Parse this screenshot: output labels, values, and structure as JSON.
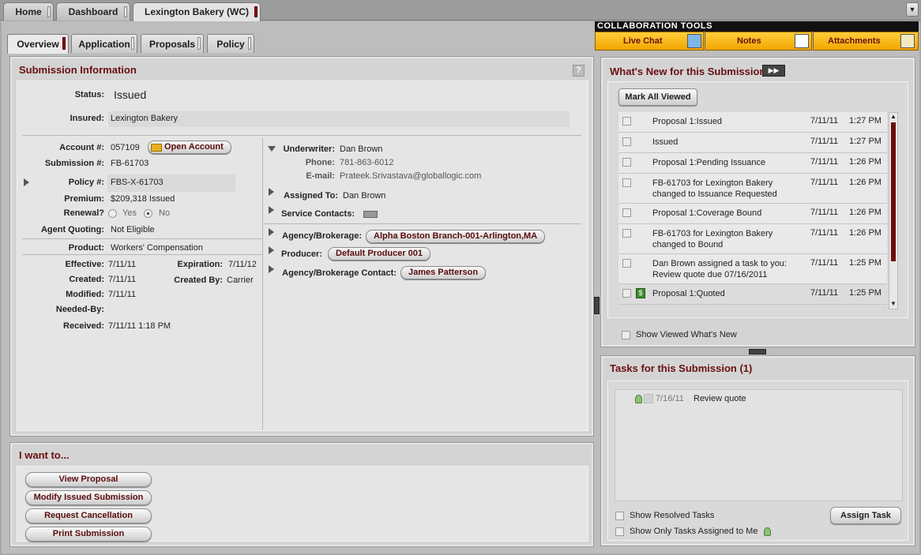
{
  "top_tabs": [
    {
      "label": "Home"
    },
    {
      "label": "Dashboard"
    },
    {
      "label": "Lexington Bakery (WC)"
    }
  ],
  "sub_tabs": [
    {
      "label": "Overview"
    },
    {
      "label": "Application"
    },
    {
      "label": "Proposals"
    },
    {
      "label": "Policy"
    }
  ],
  "collab": {
    "header": "COLLABORATION TOOLS",
    "live_chat": "Live Chat",
    "notes": "Notes",
    "attachments": "Attachments"
  },
  "submission": {
    "title": "Submission Information",
    "help": "?",
    "status_label": "Status:",
    "status_value": "Issued",
    "insured_label": "Insured:",
    "insured_value": "Lexington Bakery",
    "account_label": "Account #:",
    "account_value": "057109",
    "open_account": "Open Account",
    "submission_label": "Submission #:",
    "submission_value": "FB-61703",
    "policy_label": "Policy #:",
    "policy_value": "FBS-X-61703",
    "premium_label": "Premium:",
    "premium_value": "$209,318 Issued",
    "renewal_label": "Renewal?",
    "renewal_yes": "Yes",
    "renewal_no": "No",
    "agent_quoting_label": "Agent Quoting:",
    "agent_quoting_value": "Not Eligible",
    "product_label": "Product:",
    "product_value": "Workers' Compensation",
    "effective_label": "Effective:",
    "effective_value": "7/11/11",
    "expiration_label": "Expiration:",
    "expiration_value": "7/11/12",
    "created_label": "Created:",
    "created_value": "7/11/11",
    "created_by_label": "Created By:",
    "created_by_value": "Carrier",
    "modified_label": "Modified:",
    "modified_value": "7/11/11",
    "needed_by_label": "Needed-By:",
    "received_label": "Received:",
    "received_value": "7/11/11 1:18 PM",
    "underwriter_label": "Underwriter:",
    "underwriter_value": "Dan Brown",
    "phone_label": "Phone:",
    "phone_value": "781-863-6012",
    "email_label": "E-mail:",
    "email_value": "Prateek.Srivastava@globallogic.com",
    "assigned_label": "Assigned To:",
    "assigned_value": "Dan Brown",
    "service_label": "Service Contacts:",
    "agency_label": "Agency/Brokerage:",
    "agency_value": "Alpha Boston Branch-001-Arlington,MA",
    "producer_label": "Producer:",
    "producer_value": "Default Producer 001",
    "agency_contact_label": "Agency/Brokerage Contact:",
    "agency_contact_value": "James Patterson"
  },
  "iwant": {
    "title": "I want to...",
    "buttons": [
      "View Proposal",
      "Modify Issued Submission",
      "Request Cancellation",
      "Print Submission"
    ]
  },
  "whats_new": {
    "title": "What's New for this Submission",
    "mark_all": "Mark All Viewed",
    "show_viewed": "Show Viewed What's New",
    "rows": [
      {
        "text": "Proposal 1:Issued",
        "date": "7/11/11",
        "time": "1:27 PM"
      },
      {
        "text": "Issued",
        "date": "7/11/11",
        "time": "1:27 PM"
      },
      {
        "text": "Proposal 1:Pending Issuance",
        "date": "7/11/11",
        "time": "1:26 PM"
      },
      {
        "text": "FB-61703 for Lexington Bakery changed to Issuance Requested",
        "date": "7/11/11",
        "time": "1:26 PM"
      },
      {
        "text": "Proposal 1:Coverage Bound",
        "date": "7/11/11",
        "time": "1:26 PM"
      },
      {
        "text": "FB-61703 for Lexington Bakery changed to Bound",
        "date": "7/11/11",
        "time": "1:26 PM"
      },
      {
        "text": "Dan Brown assigned a task to you: Review quote due 07/16/2011",
        "date": "7/11/11",
        "time": "1:25 PM"
      },
      {
        "text": "Proposal 1:Quoted",
        "date": "7/11/11",
        "time": "1:25 PM"
      }
    ]
  },
  "tasks": {
    "title": "Tasks for this Submission (1)",
    "items": [
      {
        "date": "7/16/11",
        "text": "Review quote"
      }
    ],
    "show_resolved": "Show Resolved Tasks",
    "show_mine": "Show Only Tasks Assigned to Me",
    "assign_task": "Assign Task"
  },
  "colors": {
    "accent": "#6a0f0f",
    "collab_yellow": "#f7b500"
  }
}
